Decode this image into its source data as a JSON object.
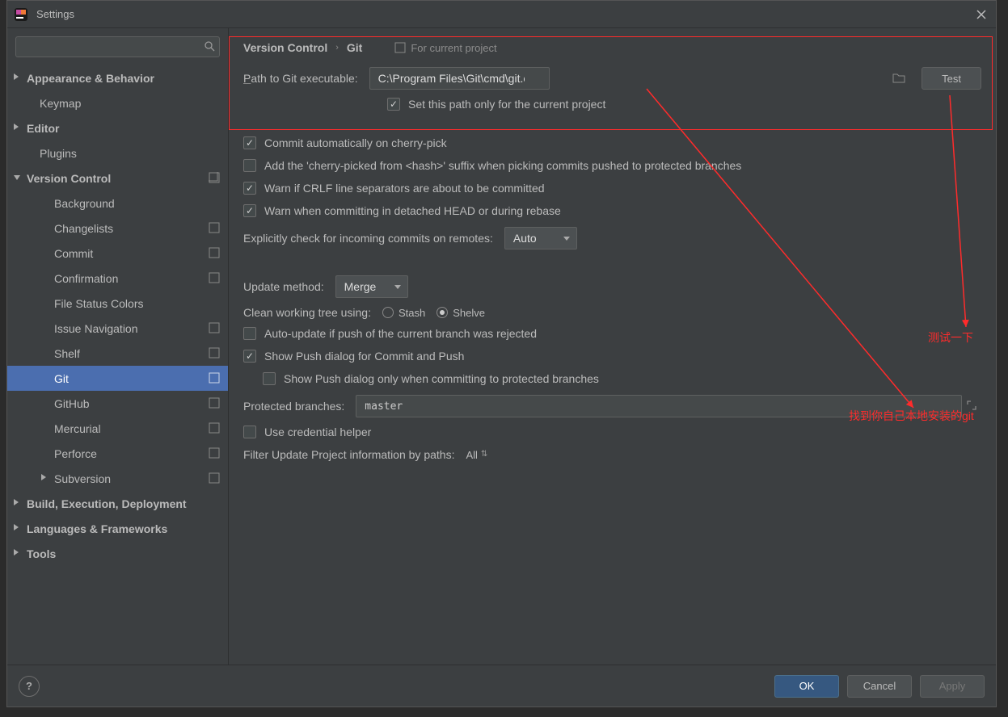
{
  "window": {
    "title": "Settings"
  },
  "search": {
    "placeholder": ""
  },
  "tree": {
    "appearance": "Appearance & Behavior",
    "keymap": "Keymap",
    "editor": "Editor",
    "plugins": "Plugins",
    "version_control": "Version Control",
    "vc_children": {
      "background": "Background",
      "changelists": "Changelists",
      "commit": "Commit",
      "confirmation": "Confirmation",
      "file_status_colors": "File Status Colors",
      "issue_navigation": "Issue Navigation",
      "shelf": "Shelf",
      "git": "Git",
      "github": "GitHub",
      "mercurial": "Mercurial",
      "perforce": "Perforce",
      "subversion": "Subversion"
    },
    "build": "Build, Execution, Deployment",
    "languages": "Languages & Frameworks",
    "tools": "Tools"
  },
  "breadcrumb": {
    "root": "Version Control",
    "leaf": "Git",
    "scope": "For current project"
  },
  "form": {
    "path_label": "Path to Git executable:",
    "path_value": "C:\\Program Files\\Git\\cmd\\git.exe",
    "test_button": "Test",
    "set_path_project": "Set this path only for the current project",
    "commit_auto_cherry": "Commit automatically on cherry-pick",
    "add_cherry_suffix": "Add the 'cherry-picked from <hash>' suffix when picking commits pushed to protected branches",
    "warn_crlf": "Warn if CRLF line separators are about to be committed",
    "warn_detached": "Warn when committing in detached HEAD or during rebase",
    "explicit_check_label": "Explicitly check for incoming commits on remotes:",
    "explicit_check_value": "Auto",
    "update_method_label": "Update method:",
    "update_method_value": "Merge",
    "clean_tree_label": "Clean working tree using:",
    "clean_tree_stash": "Stash",
    "clean_tree_shelve": "Shelve",
    "auto_update_push_rejected": "Auto-update if push of the current branch was rejected",
    "show_push_dialog": "Show Push dialog for Commit and Push",
    "show_push_protected": "Show Push dialog only when committing to protected branches",
    "protected_branches_label": "Protected branches:",
    "protected_branches_value": "master",
    "use_credential_helper": "Use credential helper",
    "filter_update_label": "Filter Update Project information by paths:",
    "filter_update_value": "All"
  },
  "footer": {
    "ok": "OK",
    "cancel": "Cancel",
    "apply": "Apply"
  },
  "annotations": {
    "test_note": "测试一下",
    "find_git_note": "找到你自己本地安装的git"
  }
}
